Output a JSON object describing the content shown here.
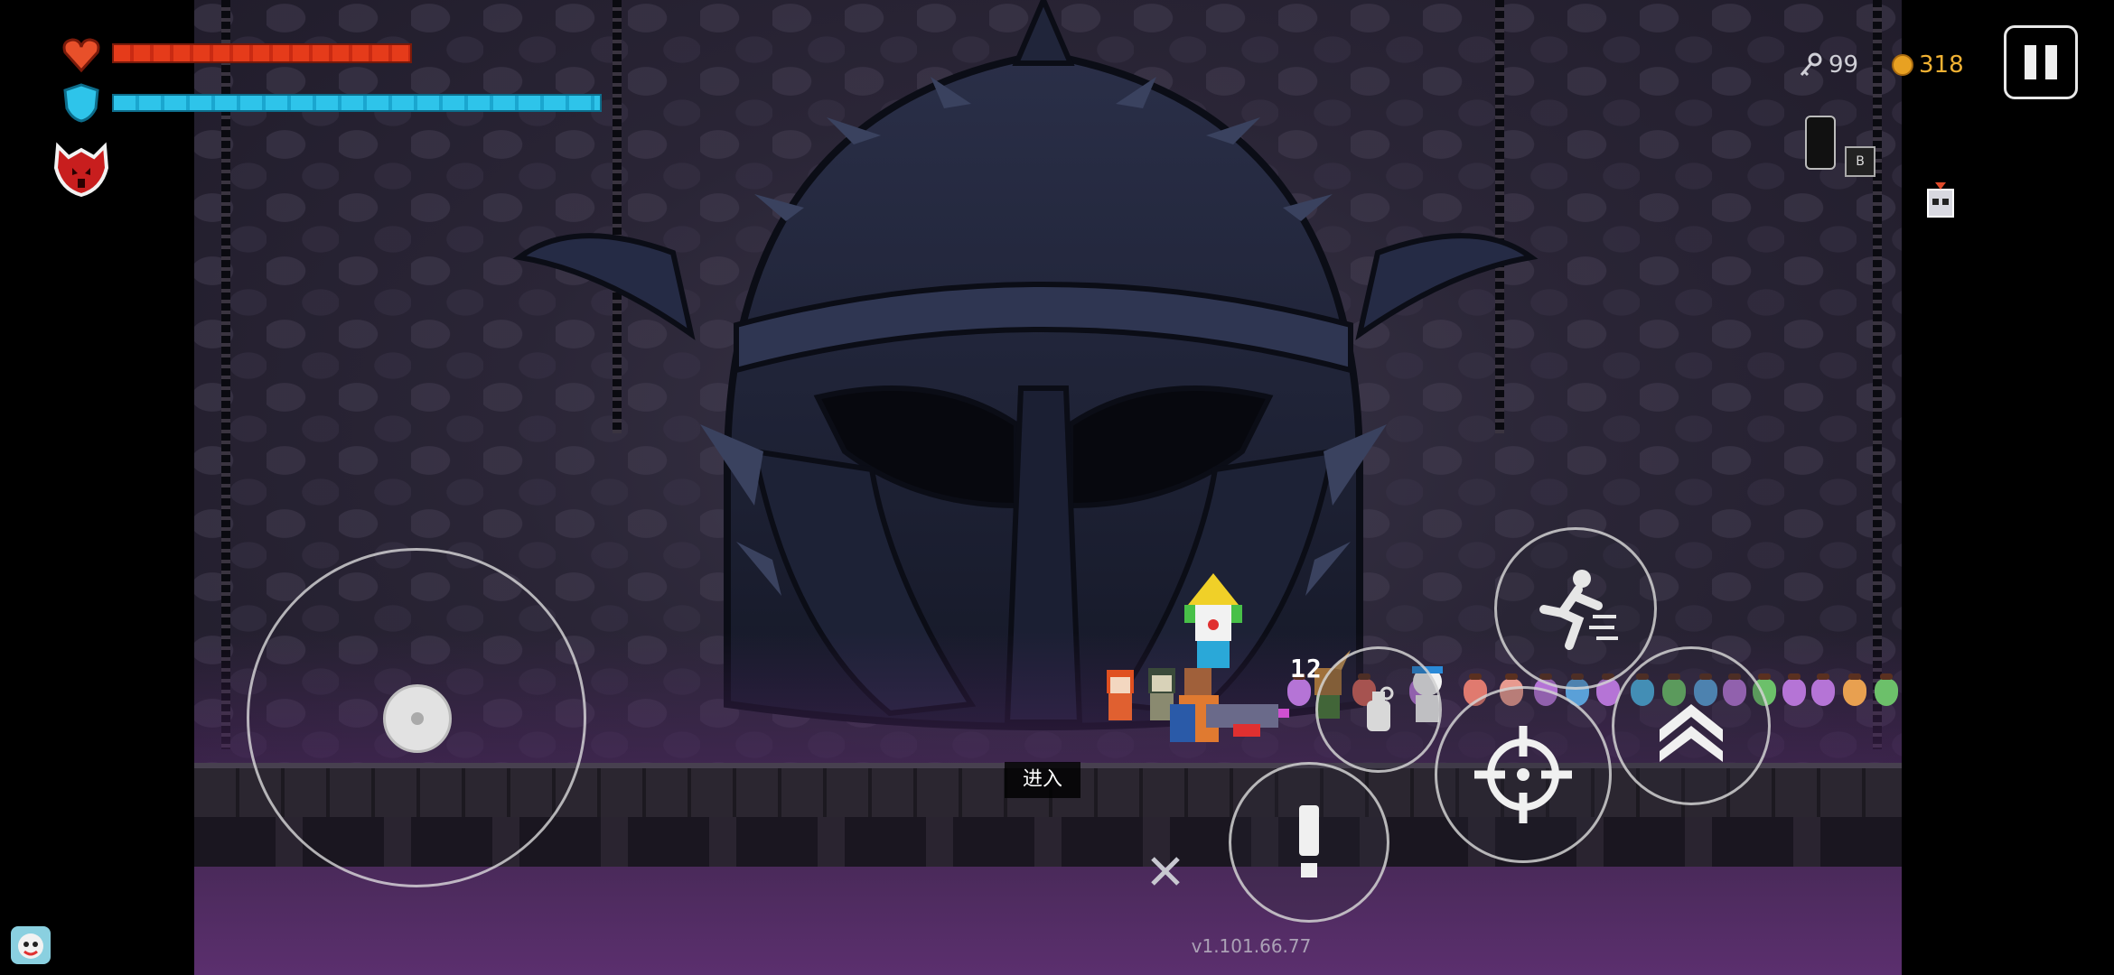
{
  "hud": {
    "health_icon": "heart-icon",
    "health_fill_fraction": 1.0,
    "shield_icon": "shield-icon",
    "shield_fill_fraction": 1.0,
    "buff_icon": "demon-skull-buff-icon",
    "keys_icon": "key-icon",
    "keys_count": "99",
    "coins_icon": "coin-icon",
    "coins_count": "318",
    "pause_icon": "pause-icon",
    "item_slot_icon": "lightbulb-item-icon",
    "item_slot_small_label": "B",
    "pet_icon": "skull-pet-icon",
    "avatar_icon": "player-avatar-icon"
  },
  "scene": {
    "interact_prompt": "进入",
    "ammo_count": "12",
    "version": "v1.101.66.77",
    "colors": {
      "health": "#e53b1a",
      "shield": "#2ec4ea",
      "coin": "#f2b233",
      "abyss": "#5b2f6e"
    }
  },
  "controls": {
    "joystick": "movement-joystick",
    "skill": "dash-skill-icon",
    "switch_weapon": "switch-weapon-icon",
    "grenade": "grenade-icon",
    "attack": "crosshair-icon",
    "interact": "exclamation-icon"
  }
}
